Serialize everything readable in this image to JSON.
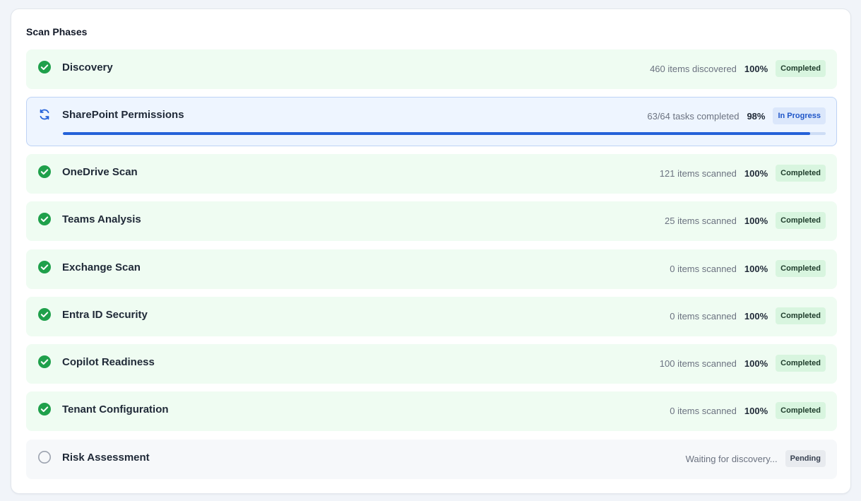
{
  "title": "Scan Phases",
  "colors": {
    "completed_bg": "#effcf2",
    "completed_icon": "#1fa04b",
    "in_progress_bg": "#eef5ff",
    "in_progress_accent": "#2461d9",
    "pending_bg": "#f6f8fa",
    "pending_icon": "#9ca3af"
  },
  "phases": [
    {
      "name": "Discovery",
      "detail": "460 items discovered",
      "percent": "100%",
      "status": "Completed",
      "icon": "check-circle-icon"
    },
    {
      "name": "SharePoint Permissions",
      "detail": "63/64 tasks completed",
      "percent": "98%",
      "status": "In Progress",
      "icon": "sync-icon",
      "progress": 0.98
    },
    {
      "name": "OneDrive Scan",
      "detail": "121 items scanned",
      "percent": "100%",
      "status": "Completed",
      "icon": "check-circle-icon"
    },
    {
      "name": "Teams Analysis",
      "detail": "25 items scanned",
      "percent": "100%",
      "status": "Completed",
      "icon": "check-circle-icon"
    },
    {
      "name": "Exchange Scan",
      "detail": "0 items scanned",
      "percent": "100%",
      "status": "Completed",
      "icon": "check-circle-icon"
    },
    {
      "name": "Entra ID Security",
      "detail": "0 items scanned",
      "percent": "100%",
      "status": "Completed",
      "icon": "check-circle-icon"
    },
    {
      "name": "Copilot Readiness",
      "detail": "100 items scanned",
      "percent": "100%",
      "status": "Completed",
      "icon": "check-circle-icon"
    },
    {
      "name": "Tenant Configuration",
      "detail": "0 items scanned",
      "percent": "100%",
      "status": "Completed",
      "icon": "check-circle-icon"
    },
    {
      "name": "Risk Assessment",
      "detail": "Waiting for discovery...",
      "status": "Pending",
      "icon": "empty-circle-icon"
    }
  ]
}
